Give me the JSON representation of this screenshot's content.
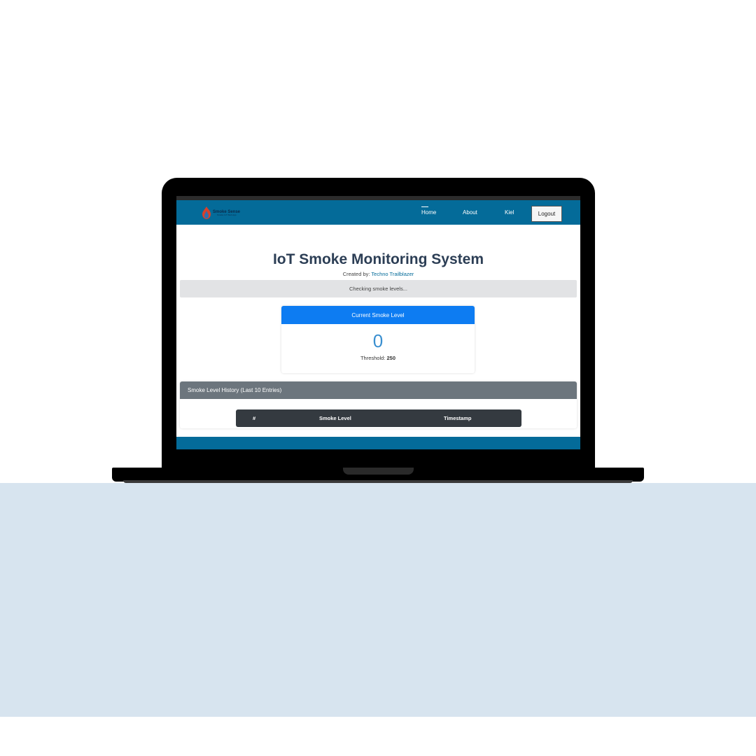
{
  "brand": {
    "name": "Smoke Sense",
    "tagline": "Smoke IoT Web App"
  },
  "nav": {
    "home": "Home",
    "about": "About",
    "user": "Kiel",
    "logout": "Logout"
  },
  "page": {
    "title": "IoT Smoke Monitoring System",
    "created_prefix": "Created by:",
    "author": "Techno Trailblazer",
    "status": "Checking smoke levels..."
  },
  "smoke_card": {
    "header": "Current Smoke Level",
    "value": "0",
    "threshold_label": "Threshold:",
    "threshold_value": "250"
  },
  "history": {
    "header": "Smoke Level History (Last 10 Entries)",
    "columns": [
      "#",
      "Smoke Level",
      "Timestamp"
    ]
  },
  "colors": {
    "navbar": "#046b99",
    "card_header": "#0d7cf2",
    "history_header": "#6c757d",
    "table_header": "#343a40",
    "desk": "#d7e4ef"
  }
}
